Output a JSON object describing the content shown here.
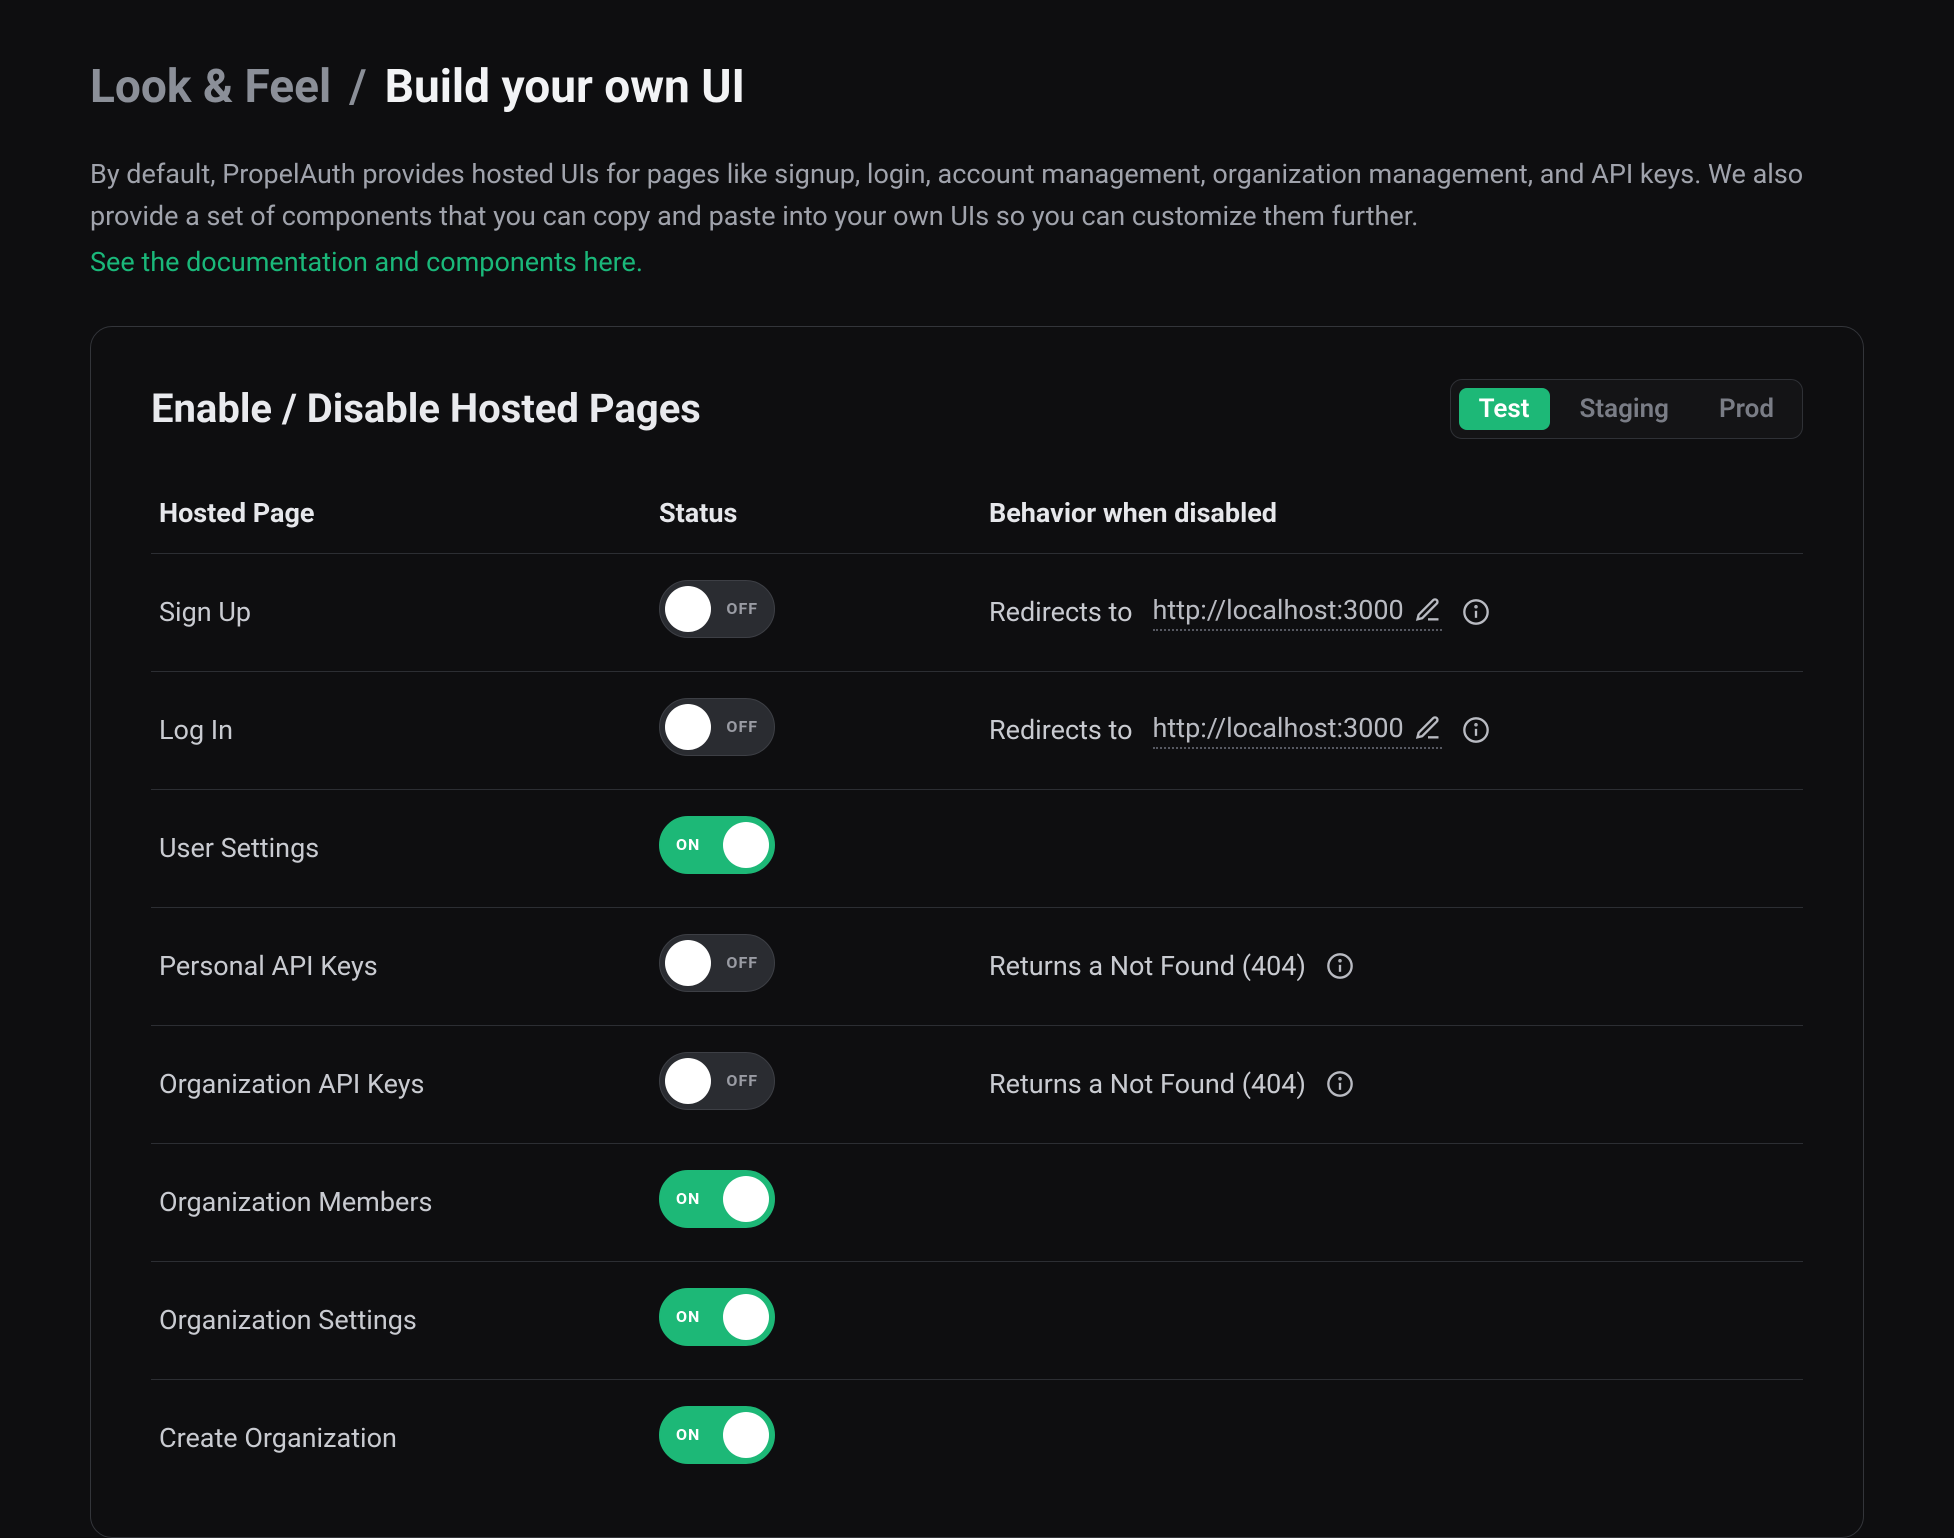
{
  "breadcrumb": {
    "parent": "Look & Feel",
    "separator": "/",
    "current": "Build your own UI"
  },
  "description": "By default, PropelAuth provides hosted UIs for pages like signup, login, account management, organization management, and API keys. We also provide a set of components that you can copy and paste into your own UIs so you can customize them further.",
  "doc_link": "See the documentation and components here.",
  "panel": {
    "title": "Enable / Disable Hosted Pages",
    "env_tabs": {
      "test": "Test",
      "staging": "Staging",
      "prod": "Prod",
      "active": "test"
    },
    "columns": {
      "page": "Hosted Page",
      "status": "Status",
      "behavior": "Behavior when disabled"
    },
    "toggle_labels": {
      "on": "ON",
      "off": "OFF"
    },
    "redirect_prefix": "Redirects to",
    "rows": [
      {
        "name": "Sign Up",
        "status": "off",
        "behavior_type": "redirect",
        "redirect_url": "http://localhost:3000"
      },
      {
        "name": "Log In",
        "status": "off",
        "behavior_type": "redirect",
        "redirect_url": "http://localhost:3000"
      },
      {
        "name": "User Settings",
        "status": "on",
        "behavior_type": "none"
      },
      {
        "name": "Personal API Keys",
        "status": "off",
        "behavior_type": "notfound",
        "behavior_text": "Returns a Not Found (404)"
      },
      {
        "name": "Organization API Keys",
        "status": "off",
        "behavior_type": "notfound",
        "behavior_text": "Returns a Not Found (404)"
      },
      {
        "name": "Organization Members",
        "status": "on",
        "behavior_type": "none"
      },
      {
        "name": "Organization Settings",
        "status": "on",
        "behavior_type": "none"
      },
      {
        "name": "Create Organization",
        "status": "on",
        "behavior_type": "none"
      }
    ]
  }
}
